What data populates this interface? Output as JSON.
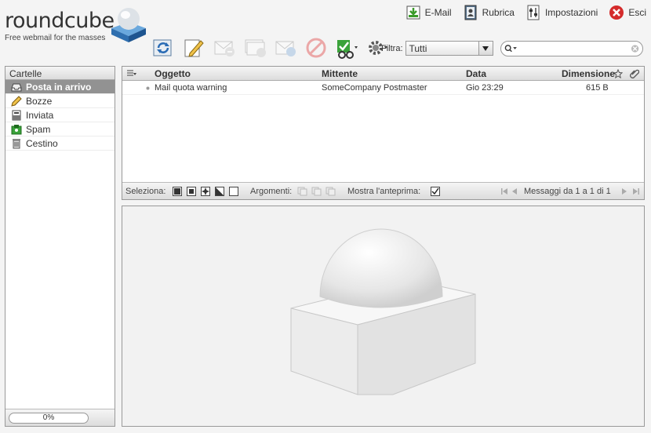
{
  "logo": {
    "wordmark": "roundcube",
    "tagline": "Free webmail for the masses"
  },
  "topnav": [
    {
      "label": "E-Mail",
      "icon": "mail-download-icon"
    },
    {
      "label": "Rubrica",
      "icon": "address-book-icon"
    },
    {
      "label": "Impostazioni",
      "icon": "settings-panel-icon"
    },
    {
      "label": "Esci",
      "icon": "logout-icon"
    }
  ],
  "toolbar": {
    "buttons": [
      "refresh",
      "compose",
      "reply",
      "reply-all",
      "forward",
      "delete",
      "mark",
      "more-actions"
    ]
  },
  "filter": {
    "label": "Filtra:",
    "selected": "Tutti"
  },
  "search": {
    "placeholder": "",
    "value": ""
  },
  "folders": {
    "title": "Cartelle",
    "items": [
      {
        "label": "Posta in arrivo",
        "icon": "inbox-icon",
        "selected": true
      },
      {
        "label": "Bozze",
        "icon": "pencil-icon",
        "selected": false
      },
      {
        "label": "Inviata",
        "icon": "sent-icon",
        "selected": false
      },
      {
        "label": "Spam",
        "icon": "spam-icon",
        "selected": false
      },
      {
        "label": "Cestino",
        "icon": "trash-icon",
        "selected": false
      }
    ],
    "quota": "0%"
  },
  "messagelist": {
    "columns": {
      "subject": "Oggetto",
      "from": "Mittente",
      "date": "Data",
      "size": "Dimensione"
    },
    "rows": [
      {
        "subject": "Mail quota warning",
        "from": "SomeCompany Postmaster",
        "date": "Gio 23:29",
        "size": "615 B"
      }
    ],
    "footer": {
      "select_label": "Seleziona:",
      "threads_label": "Argomenti:",
      "preview_label": "Mostra l'anteprima:",
      "count_text": "Messaggi da 1 a 1 di 1"
    }
  },
  "colors": {
    "selected_folder_bg": "#929292",
    "accent_blue": "#3a7fc1"
  }
}
